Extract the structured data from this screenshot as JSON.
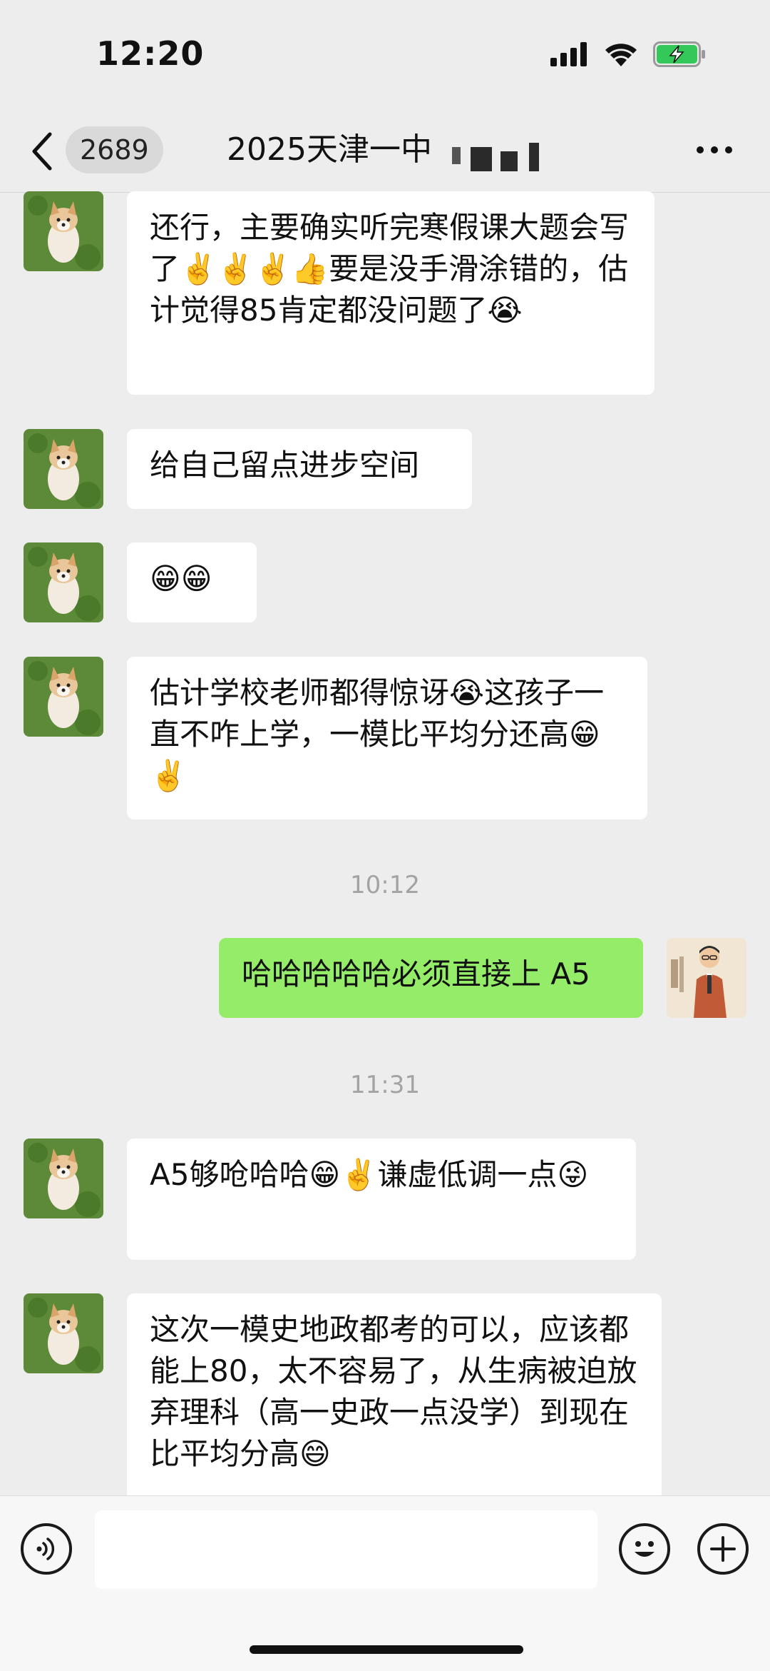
{
  "status_bar": {
    "time": "12:20"
  },
  "nav": {
    "unread_count": "2689",
    "title": "2025天津一中"
  },
  "colors": {
    "background": "#ededed",
    "incoming_bubble": "#ffffff",
    "outgoing_bubble": "#95ec69",
    "battery_fill": "#34c759"
  },
  "messages": [
    {
      "side": "left",
      "text": "还行，主要确实听完寒假课大题会写了✌️✌️✌️👍要是没手滑涂错的，估计觉得85肯定都没问题了😭"
    },
    {
      "side": "left",
      "text": "给自己留点进步空间"
    },
    {
      "side": "left",
      "text": "😁😁"
    },
    {
      "side": "left",
      "text": "估计学校老师都得惊讶😭这孩子一直不咋上学，一模比平均分还高😁✌️"
    },
    {
      "side": "time",
      "text": "10:12"
    },
    {
      "side": "right",
      "text": "哈哈哈哈哈必须直接上 A5"
    },
    {
      "side": "time",
      "text": "11:31"
    },
    {
      "side": "left",
      "text": "A5够呛哈哈😁✌️谦虚低调一点😜"
    },
    {
      "side": "left",
      "text": "这次一模史地政都考的可以，应该都能上80，太不容易了，从生病被迫放弃理科（高一史政一点没学）到现在比平均分高😄"
    }
  ],
  "input": {
    "placeholder": ""
  }
}
